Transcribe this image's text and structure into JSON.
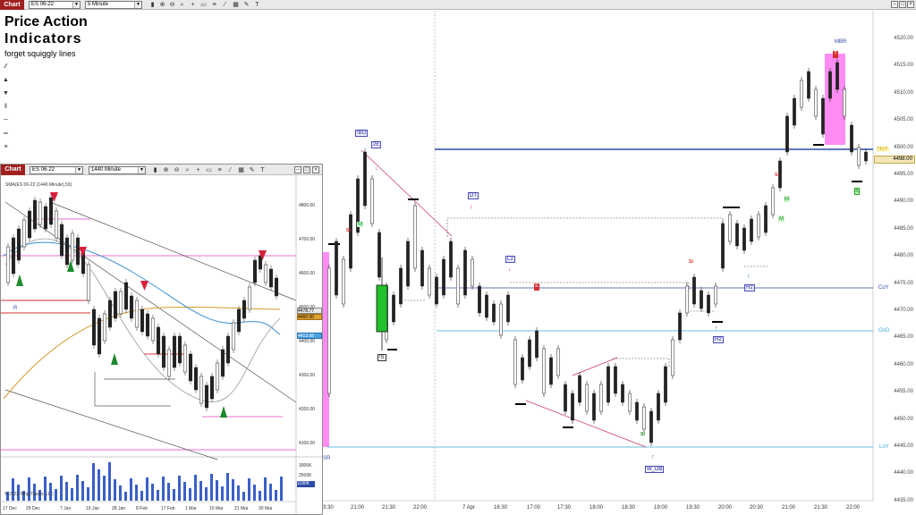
{
  "app": {
    "chart_tab_label": "Chart",
    "instrument": "ES 06-22",
    "timeframe": "5 Minute",
    "toolbar_icons": [
      "bar-chart-icon",
      "zoom-in-icon",
      "zoom-out-icon",
      "search-icon",
      "add-icon",
      "page-icon",
      "properties-icon",
      "drawing-icon",
      "template-icon",
      "drawing-tools-icon",
      "text-icon"
    ]
  },
  "overlay_title": {
    "line1": "Price Action",
    "line2": "Indicators",
    "line3": "forget squiggly lines"
  },
  "main_chart": {
    "price_ticks": [
      "4520.00",
      "4515.00",
      "4510.00",
      "4505.00",
      "4500.00",
      "4495.00",
      "4490.00",
      "4485.00",
      "4480.00",
      "4475.00",
      "4470.00",
      "4465.00",
      "4460.00",
      "4455.00",
      "4450.00",
      "4445.00",
      "4440.00",
      "4435.00"
    ],
    "time_ticks": [
      "3:30",
      "21:00",
      "21:30",
      "22:00",
      "7 Apr",
      "16:30",
      "17:00",
      "17:30",
      "18:00",
      "18:30",
      "19:00",
      "19:30",
      "20:00",
      "20:30",
      "21:00",
      "21:30",
      "22:00"
    ],
    "current_price": "4498.00",
    "level_labels": {
      "hoy": "HoY",
      "coy": "CoY",
      "ood": "OoD",
      "loy": "LoY"
    },
    "annotations": {
      "bo": "!BO",
      "two_e": "2E",
      "dt": "DT",
      "l2": "L2",
      "mbr": "MBR",
      "h2": "H2",
      "h2b": "H2",
      "w_db": "W_DB",
      "sr": "SR",
      "st": "St",
      "m": "M",
      "ss": "!S",
      "e": "E",
      "l": "L",
      "t": "T",
      "b": "B"
    }
  },
  "inset_chart": {
    "chart_tab_label": "Chart",
    "instrument": "ES 06-22",
    "timeframe": "1440 Minute",
    "sma_label": "SMA(ES 06-22 (1440 Minute),50)",
    "price_ticks": [
      "4800.00",
      "4700.00",
      "4600.00",
      "4500.00",
      "4400.00",
      "4300.00",
      "4200.00",
      "4100.00"
    ],
    "tag_high": "4478.77",
    "tag_mid": "4460.00",
    "tag_low": "4412.68",
    "r_label": "R",
    "vol_ticks": [
      "3000K",
      "2500K",
      "2000K"
    ],
    "vol_tag": "1180K",
    "copyright": "© 2022 NinjaTrader, LLC",
    "time_ticks": [
      "17 Dec",
      "29 Dec",
      "7 Jan",
      "19 Jan",
      "28 Jan",
      "8 Feb",
      "17 Feb",
      "1 Mar",
      "10 Mar",
      "21 Mar",
      "30 Mar"
    ]
  },
  "colors": {
    "bull": "#22c02a",
    "bear": "#000000",
    "pink_zone": "#ff66ee",
    "blue_line": "#2e4aa8",
    "cyan_line": "#39a9d8",
    "red_line": "#d83030",
    "chart_tab": "#a02020"
  }
}
